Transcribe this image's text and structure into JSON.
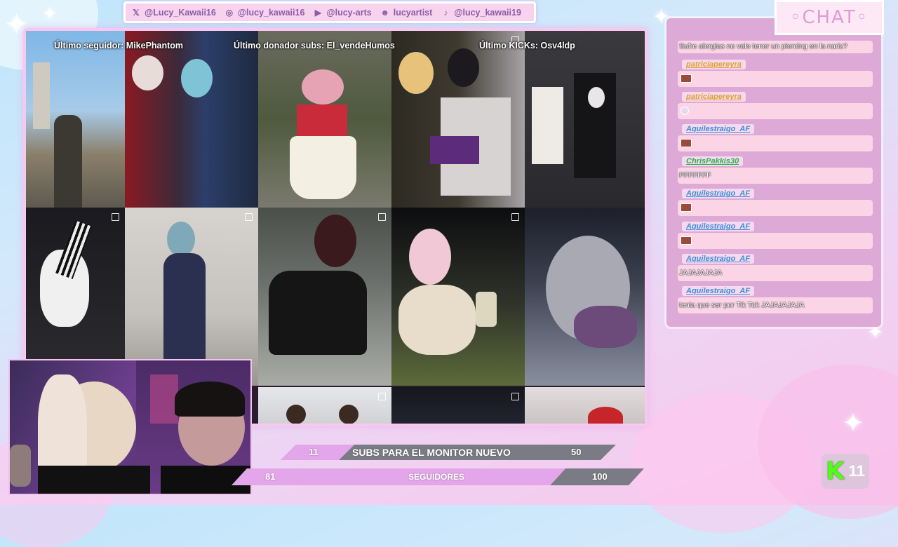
{
  "social": [
    {
      "icon": "x-icon",
      "glyph": "𝕏",
      "handle": "@Lucy_Kawaii16"
    },
    {
      "icon": "instagram-icon",
      "glyph": "◎",
      "handle": "@lucy_kawaii16"
    },
    {
      "icon": "youtube-icon",
      "glyph": "▶",
      "handle": "@lucy-arts"
    },
    {
      "icon": "discord-icon",
      "glyph": "☻",
      "handle": "lucyartist"
    },
    {
      "icon": "tiktok-icon",
      "glyph": "♪",
      "handle": "@lucy_kawaii19"
    }
  ],
  "overlay": {
    "last_follower": "Último seguidor: MikePhantom",
    "last_donor": "Último donador subs: El_vendeHumos",
    "last_kicks": "Último KICKs: Osv4ldp"
  },
  "goals": {
    "subs": {
      "current": "11",
      "label": "SUBS PARA EL MONITOR NUEVO",
      "target": "50",
      "progress": 0.22
    },
    "followers": {
      "current": "81",
      "label": "SEGUIDORES",
      "target": "100",
      "progress": 0.81
    }
  },
  "chat": {
    "title": "◦CHAT◦",
    "top_message": "Sufre alergias no vale tener un piercing en la nariz?",
    "messages": [
      {
        "user": "patriciapereyra",
        "color": "#e0a030",
        "text": "",
        "emote": "face"
      },
      {
        "user": "patriciapereyra",
        "color": "#e0a030",
        "text": "",
        "emote": "ghost"
      },
      {
        "user": "Aquilestraigo_AF",
        "color": "#3a8fd8",
        "text": "",
        "emote": "face"
      },
      {
        "user": "ChrisPakkis30",
        "color": "#27b34a",
        "text": "PFFFFFF",
        "emote": ""
      },
      {
        "user": "Aquilestraigo_AF",
        "color": "#3a8fd8",
        "text": "",
        "emote": "face"
      },
      {
        "user": "Aquilestraigo_AF",
        "color": "#3a8fd8",
        "text": "",
        "emote": "face"
      },
      {
        "user": "Aquilestraigo_AF",
        "color": "#3a8fd8",
        "text": "JAJAJAJAJA",
        "emote": ""
      },
      {
        "user": "Aquilestraigo_AF",
        "color": "#3a8fd8",
        "text": "tenia que ser por Tik Tok JAJAJAJAJA",
        "emote": ""
      }
    ]
  },
  "kick": {
    "count": "11",
    "logo": "K"
  },
  "colors": {
    "accent": "#f7c9ef",
    "goal_fill": "#e4a6ea",
    "goal_rest": "#7d7d87",
    "kick_green": "#53fc18"
  }
}
